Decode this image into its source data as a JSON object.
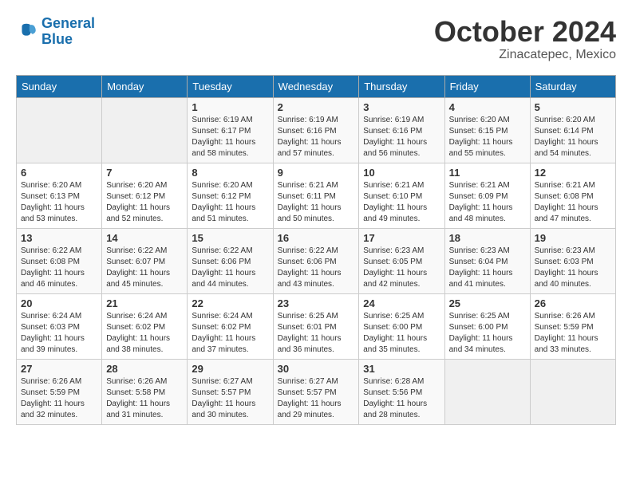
{
  "logo": {
    "line1": "General",
    "line2": "Blue"
  },
  "title": "October 2024",
  "location": "Zinacatepec, Mexico",
  "headers": [
    "Sunday",
    "Monday",
    "Tuesday",
    "Wednesday",
    "Thursday",
    "Friday",
    "Saturday"
  ],
  "weeks": [
    [
      {
        "day": "",
        "info": ""
      },
      {
        "day": "",
        "info": ""
      },
      {
        "day": "1",
        "info": "Sunrise: 6:19 AM\nSunset: 6:17 PM\nDaylight: 11 hours\nand 58 minutes."
      },
      {
        "day": "2",
        "info": "Sunrise: 6:19 AM\nSunset: 6:16 PM\nDaylight: 11 hours\nand 57 minutes."
      },
      {
        "day": "3",
        "info": "Sunrise: 6:19 AM\nSunset: 6:16 PM\nDaylight: 11 hours\nand 56 minutes."
      },
      {
        "day": "4",
        "info": "Sunrise: 6:20 AM\nSunset: 6:15 PM\nDaylight: 11 hours\nand 55 minutes."
      },
      {
        "day": "5",
        "info": "Sunrise: 6:20 AM\nSunset: 6:14 PM\nDaylight: 11 hours\nand 54 minutes."
      }
    ],
    [
      {
        "day": "6",
        "info": "Sunrise: 6:20 AM\nSunset: 6:13 PM\nDaylight: 11 hours\nand 53 minutes."
      },
      {
        "day": "7",
        "info": "Sunrise: 6:20 AM\nSunset: 6:12 PM\nDaylight: 11 hours\nand 52 minutes."
      },
      {
        "day": "8",
        "info": "Sunrise: 6:20 AM\nSunset: 6:12 PM\nDaylight: 11 hours\nand 51 minutes."
      },
      {
        "day": "9",
        "info": "Sunrise: 6:21 AM\nSunset: 6:11 PM\nDaylight: 11 hours\nand 50 minutes."
      },
      {
        "day": "10",
        "info": "Sunrise: 6:21 AM\nSunset: 6:10 PM\nDaylight: 11 hours\nand 49 minutes."
      },
      {
        "day": "11",
        "info": "Sunrise: 6:21 AM\nSunset: 6:09 PM\nDaylight: 11 hours\nand 48 minutes."
      },
      {
        "day": "12",
        "info": "Sunrise: 6:21 AM\nSunset: 6:08 PM\nDaylight: 11 hours\nand 47 minutes."
      }
    ],
    [
      {
        "day": "13",
        "info": "Sunrise: 6:22 AM\nSunset: 6:08 PM\nDaylight: 11 hours\nand 46 minutes."
      },
      {
        "day": "14",
        "info": "Sunrise: 6:22 AM\nSunset: 6:07 PM\nDaylight: 11 hours\nand 45 minutes."
      },
      {
        "day": "15",
        "info": "Sunrise: 6:22 AM\nSunset: 6:06 PM\nDaylight: 11 hours\nand 44 minutes."
      },
      {
        "day": "16",
        "info": "Sunrise: 6:22 AM\nSunset: 6:06 PM\nDaylight: 11 hours\nand 43 minutes."
      },
      {
        "day": "17",
        "info": "Sunrise: 6:23 AM\nSunset: 6:05 PM\nDaylight: 11 hours\nand 42 minutes."
      },
      {
        "day": "18",
        "info": "Sunrise: 6:23 AM\nSunset: 6:04 PM\nDaylight: 11 hours\nand 41 minutes."
      },
      {
        "day": "19",
        "info": "Sunrise: 6:23 AM\nSunset: 6:03 PM\nDaylight: 11 hours\nand 40 minutes."
      }
    ],
    [
      {
        "day": "20",
        "info": "Sunrise: 6:24 AM\nSunset: 6:03 PM\nDaylight: 11 hours\nand 39 minutes."
      },
      {
        "day": "21",
        "info": "Sunrise: 6:24 AM\nSunset: 6:02 PM\nDaylight: 11 hours\nand 38 minutes."
      },
      {
        "day": "22",
        "info": "Sunrise: 6:24 AM\nSunset: 6:02 PM\nDaylight: 11 hours\nand 37 minutes."
      },
      {
        "day": "23",
        "info": "Sunrise: 6:25 AM\nSunset: 6:01 PM\nDaylight: 11 hours\nand 36 minutes."
      },
      {
        "day": "24",
        "info": "Sunrise: 6:25 AM\nSunset: 6:00 PM\nDaylight: 11 hours\nand 35 minutes."
      },
      {
        "day": "25",
        "info": "Sunrise: 6:25 AM\nSunset: 6:00 PM\nDaylight: 11 hours\nand 34 minutes."
      },
      {
        "day": "26",
        "info": "Sunrise: 6:26 AM\nSunset: 5:59 PM\nDaylight: 11 hours\nand 33 minutes."
      }
    ],
    [
      {
        "day": "27",
        "info": "Sunrise: 6:26 AM\nSunset: 5:59 PM\nDaylight: 11 hours\nand 32 minutes."
      },
      {
        "day": "28",
        "info": "Sunrise: 6:26 AM\nSunset: 5:58 PM\nDaylight: 11 hours\nand 31 minutes."
      },
      {
        "day": "29",
        "info": "Sunrise: 6:27 AM\nSunset: 5:57 PM\nDaylight: 11 hours\nand 30 minutes."
      },
      {
        "day": "30",
        "info": "Sunrise: 6:27 AM\nSunset: 5:57 PM\nDaylight: 11 hours\nand 29 minutes."
      },
      {
        "day": "31",
        "info": "Sunrise: 6:28 AM\nSunset: 5:56 PM\nDaylight: 11 hours\nand 28 minutes."
      },
      {
        "day": "",
        "info": ""
      },
      {
        "day": "",
        "info": ""
      }
    ]
  ]
}
